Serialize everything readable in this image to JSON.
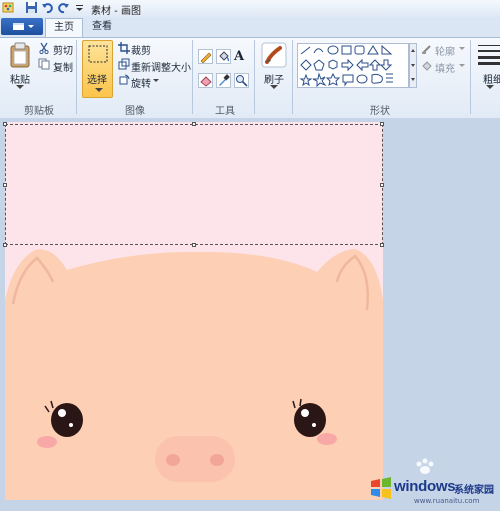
{
  "window": {
    "title": "素材 - 画图"
  },
  "tabs": [
    {
      "label": "主页"
    },
    {
      "label": "查看"
    }
  ],
  "clipboard": {
    "paste_label": "粘贴",
    "cut_label": "剪切",
    "copy_label": "复制",
    "group_label": "剪贴板"
  },
  "image": {
    "select_label": "选择",
    "crop_label": "裁剪",
    "resize_label": "重新调整大小",
    "rotate_label": "旋转",
    "group_label": "图像"
  },
  "tools": {
    "group_label": "工具",
    "text_glyph": "A"
  },
  "brushes": {
    "label": "刷子"
  },
  "shapes": {
    "outline_label": "轮廓",
    "fill_label": "填充",
    "group_label": "形状"
  },
  "size": {
    "label": "粗细"
  },
  "watermark": {
    "brand": "windows",
    "site": "系统家园",
    "url": "www.ruanaitu.com"
  },
  "colors": {
    "ribbon_bg": "#e1eaf6",
    "file_tab": "#2a5fb2",
    "canvas_pink_light": "#fde4ea",
    "pig_skin": "#fdd0b6",
    "pig_cheek": "#f8a8a6",
    "pig_eye": "#2b1616"
  }
}
